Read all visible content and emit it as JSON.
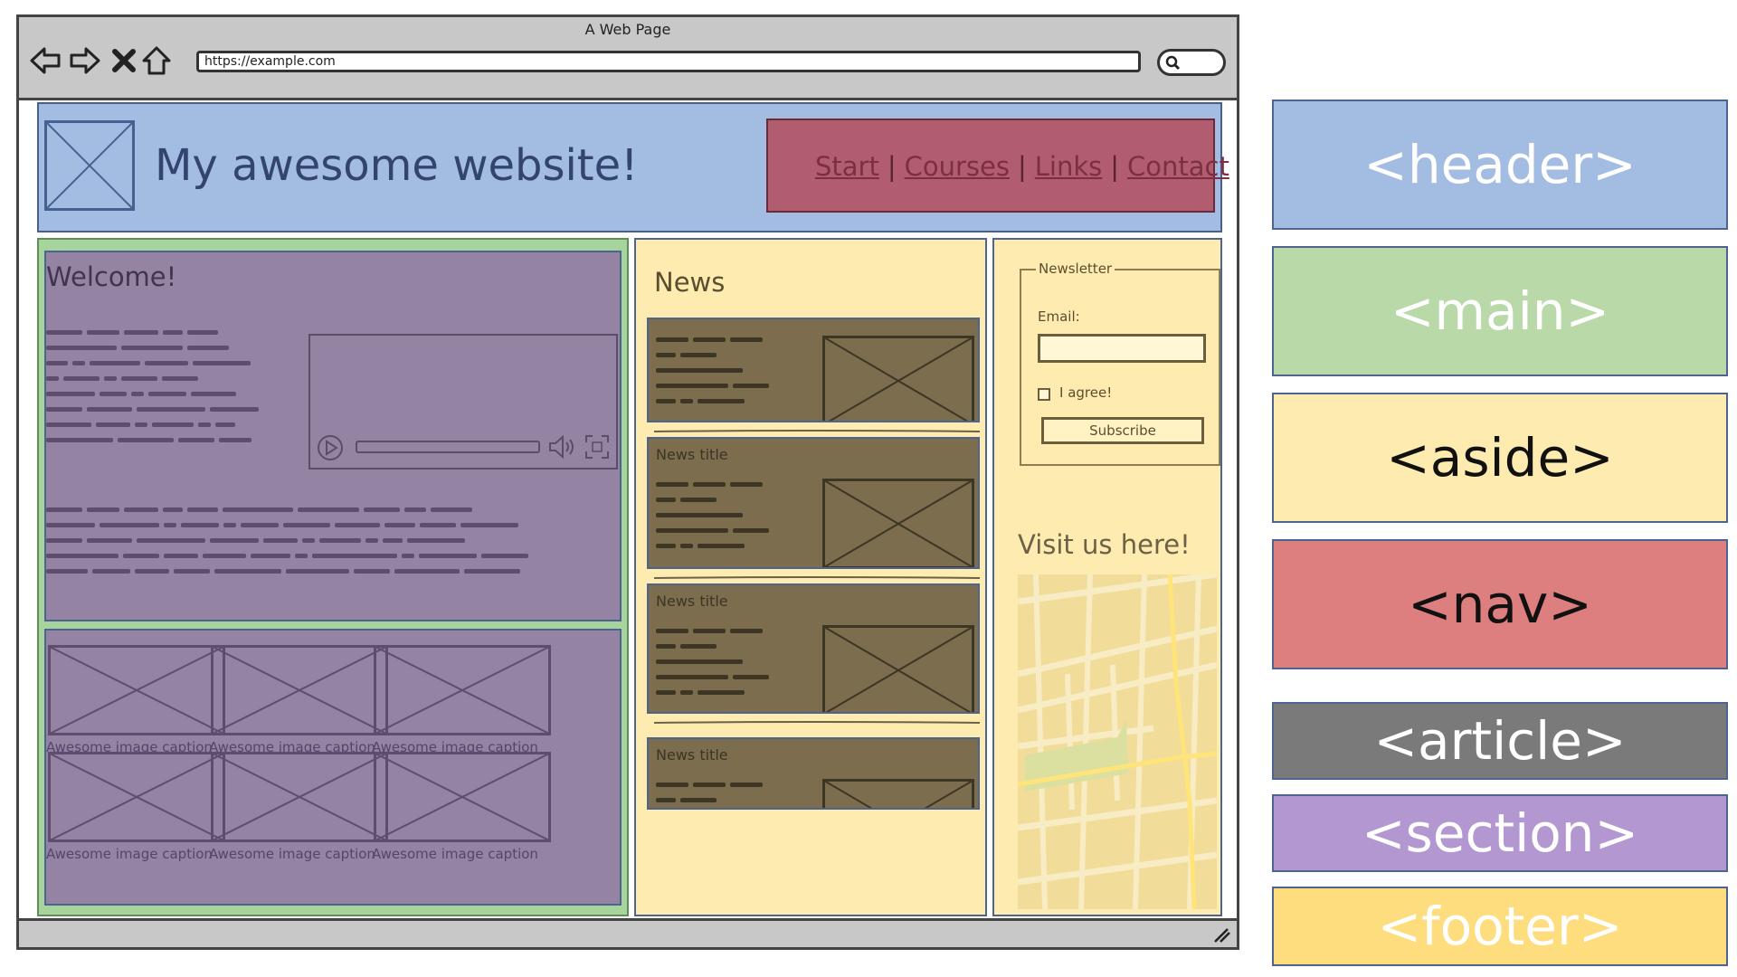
{
  "browser": {
    "window_title": "A Web Page",
    "url": "https://example.com"
  },
  "header": {
    "site_title": "My awesome website!",
    "nav": [
      "Start",
      "Courses",
      "Links",
      "Contact"
    ],
    "nav_separator": "|"
  },
  "main": {
    "welcome_title": "Welcome!",
    "gallery_caption": "Awesome image caption",
    "gallery_count": 6
  },
  "news": {
    "title": "News",
    "article_title": "News title",
    "article_count": 4
  },
  "aside": {
    "newsletter_legend": "Newsletter",
    "email_label": "Email:",
    "email_value": "",
    "agree_label": "I agree!",
    "agree_checked": false,
    "subscribe_label": "Subscribe",
    "visit_title": "Visit us here!"
  },
  "legend": [
    {
      "label": "<header>",
      "color": "#a3bde2",
      "text_color": "#ffffff"
    },
    {
      "label": "<main>",
      "color": "#b9d9a9",
      "text_color": "#ffffff"
    },
    {
      "label": "<aside>",
      "color": "#feebb0",
      "text_color": "#111111"
    },
    {
      "label": "<nav>",
      "color": "#dd7f7e",
      "text_color": "#111111"
    },
    {
      "label": "<article>",
      "color": "#7a7a7a",
      "text_color": "#ffffff"
    },
    {
      "label": "<section>",
      "color": "#b397d1",
      "text_color": "#ffffff"
    },
    {
      "label": "<footer>",
      "color": "#fedd7f",
      "text_color": "#ffffff"
    }
  ]
}
